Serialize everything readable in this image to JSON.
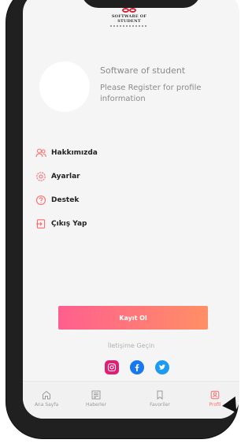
{
  "logo": {
    "line1": "SOFTWARE OF",
    "line2": "STUDENT"
  },
  "profile": {
    "name": "Software of student",
    "subtitle": "Please Register for profile information"
  },
  "menu": {
    "items": [
      {
        "label": "Hakkımızda",
        "icon": "people-icon"
      },
      {
        "label": "Ayarlar",
        "icon": "settings-icon"
      },
      {
        "label": "Destek",
        "icon": "help-icon"
      },
      {
        "label": "Çıkış Yap",
        "icon": "logout-icon"
      }
    ]
  },
  "register_button": {
    "label": "Kayıt Ol"
  },
  "contact": {
    "label": "İletişime Geçin",
    "socials": [
      "instagram-icon",
      "facebook-icon",
      "twitter-icon"
    ]
  },
  "bottom_nav": {
    "items": [
      {
        "label": "Ana Sayfa",
        "icon": "home-icon",
        "active": false
      },
      {
        "label": "Haberler",
        "icon": "newspaper-icon",
        "active": false
      },
      {
        "label": "Favoriler",
        "icon": "bookmark-icon",
        "active": false
      },
      {
        "label": "Profil",
        "icon": "profile-icon",
        "active": true
      }
    ]
  },
  "colors": {
    "accent": "#ff6b6b",
    "button_gradient_start": "#ff5f8e",
    "button_gradient_end": "#ff8f66",
    "instagram": "#e11d74",
    "facebook": "#1778f2",
    "twitter": "#1d9bf0"
  }
}
